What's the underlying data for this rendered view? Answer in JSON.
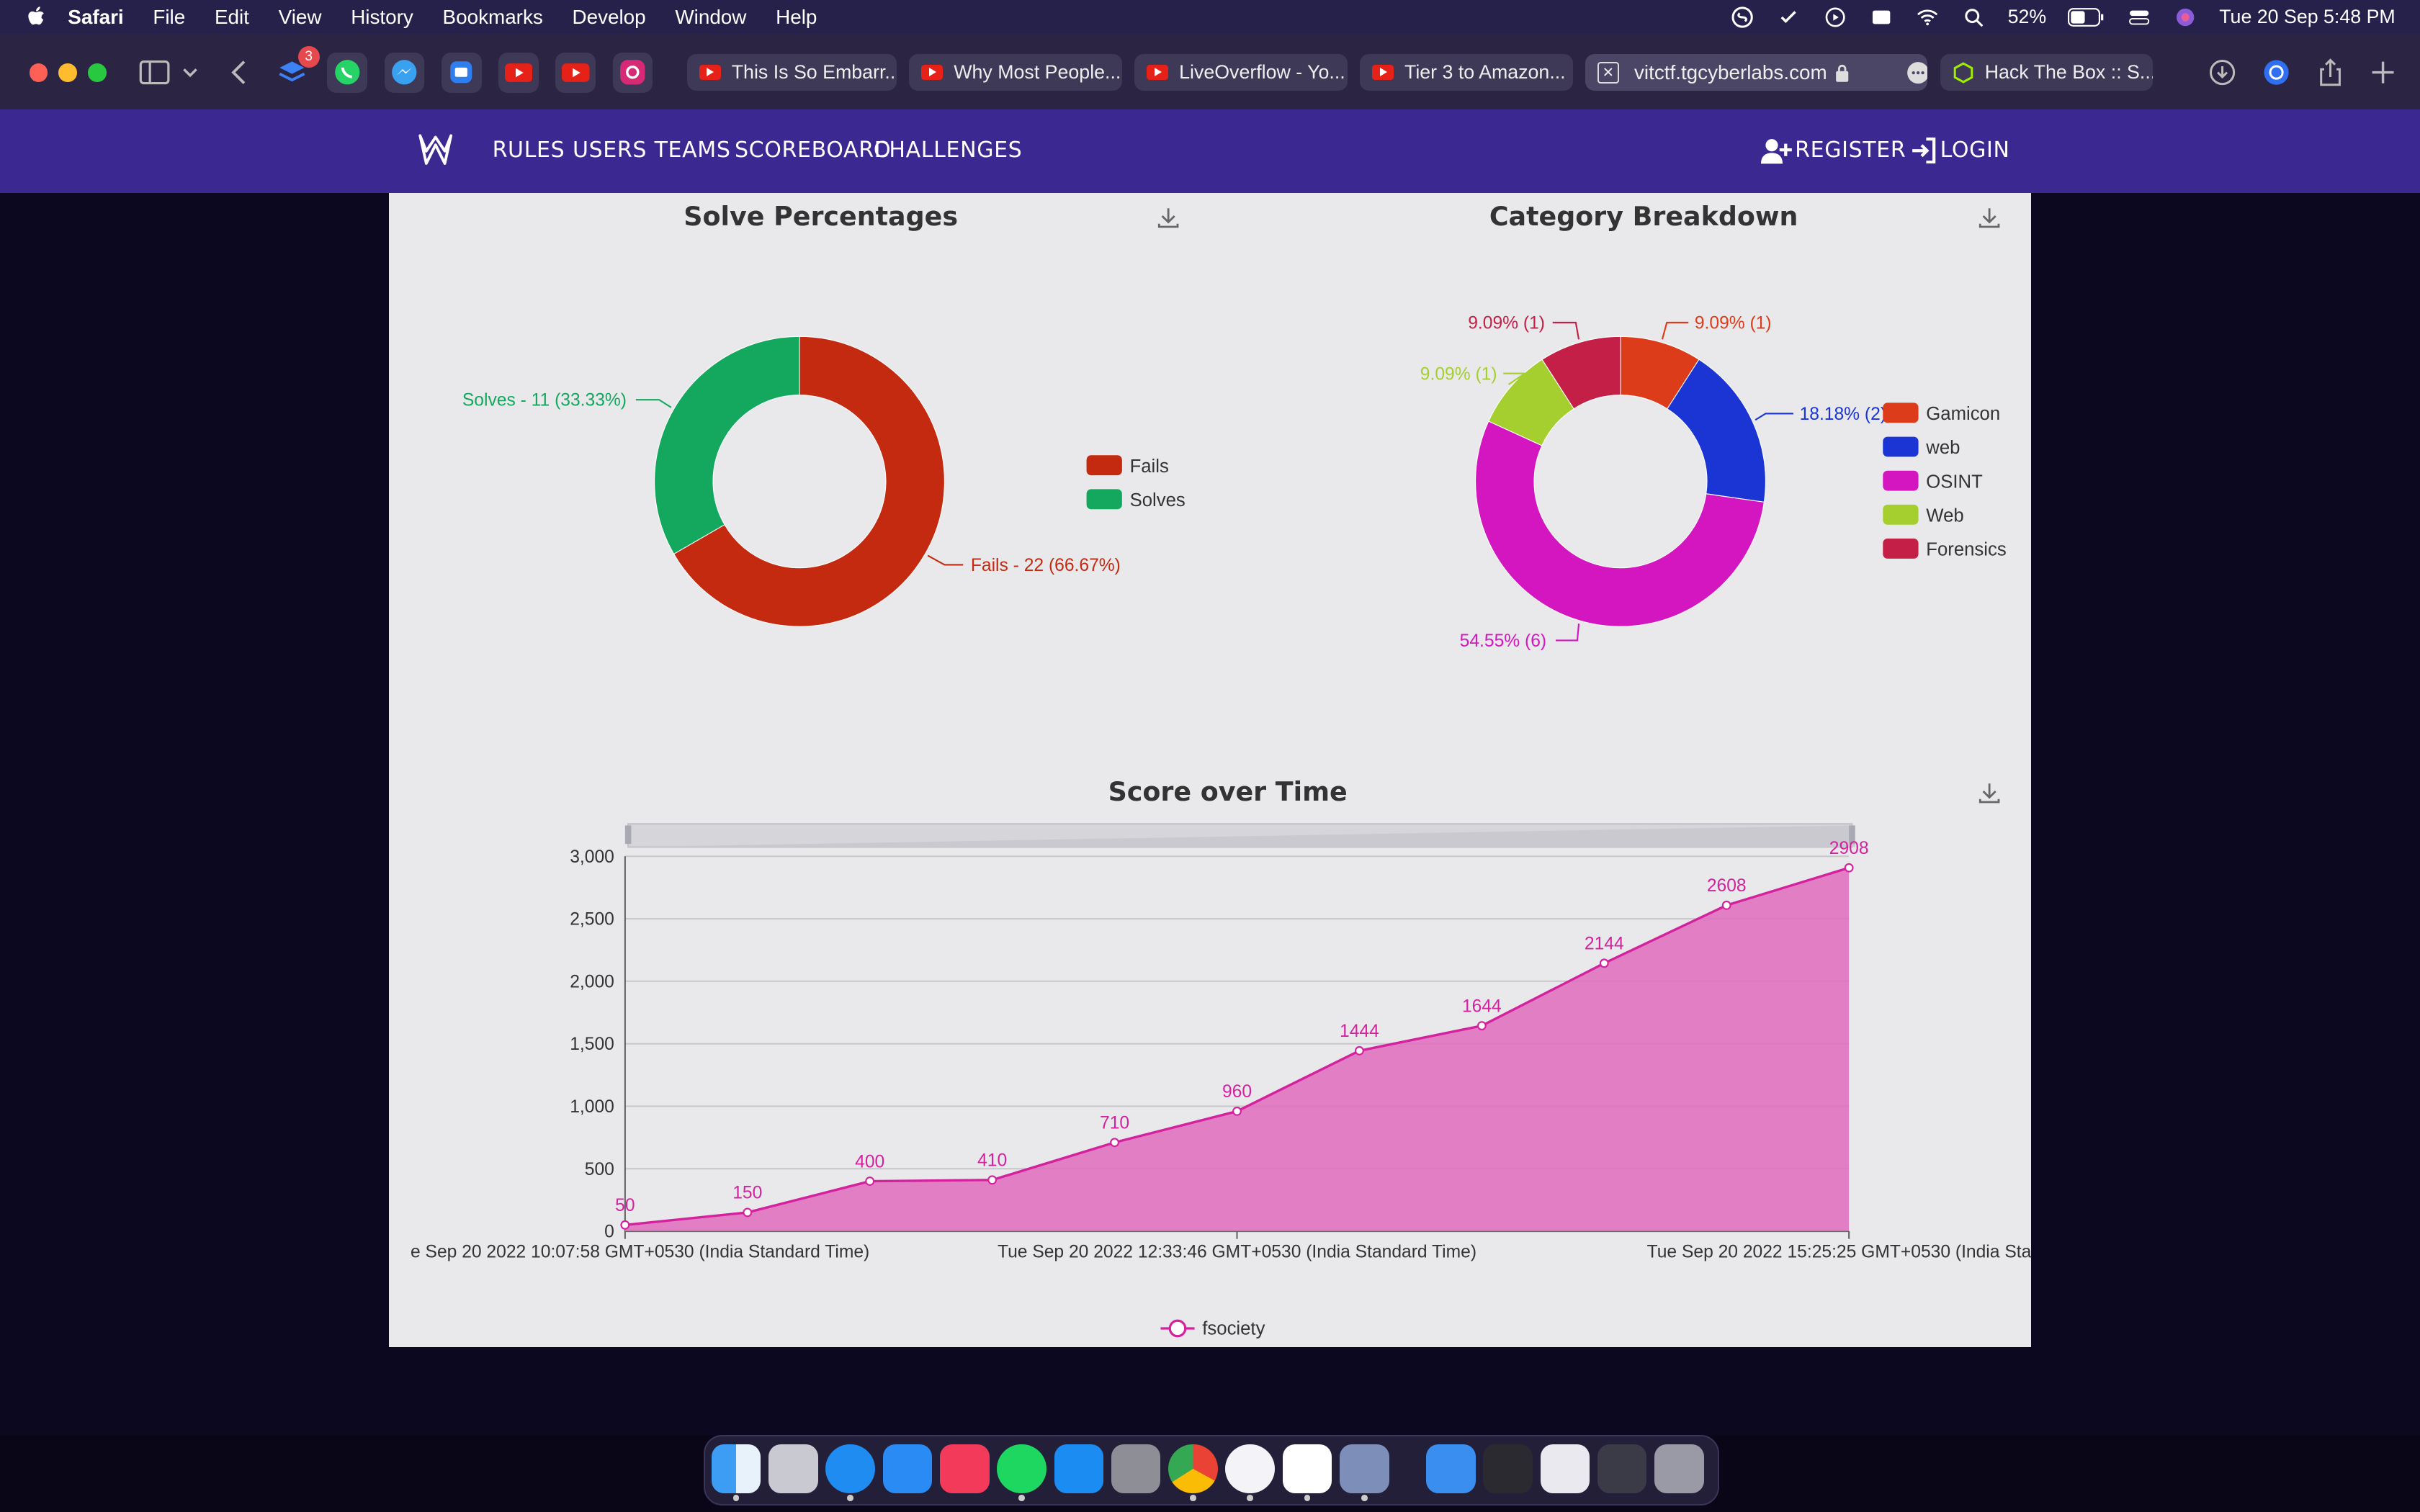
{
  "menubar": {
    "app": "Safari",
    "items": [
      "File",
      "Edit",
      "View",
      "History",
      "Bookmarks",
      "Develop",
      "Window",
      "Help"
    ],
    "battery": "52%",
    "datetime": "Tue 20 Sep  5:48 PM"
  },
  "toolbar": {
    "badge_count": "3",
    "tabs": [
      {
        "title": "This Is So Embarr..."
      },
      {
        "title": "Why Most People..."
      },
      {
        "title": "LiveOverflow - Yo..."
      },
      {
        "title": "Tier 3 to Amazon..."
      },
      {
        "title": "vitctf.tgcyberlabs.com"
      },
      {
        "title": "Hack The Box :: S..."
      }
    ]
  },
  "navbar": {
    "links": [
      "RULES",
      "USERS",
      "TEAMS",
      "SCOREBOARD",
      "CHALLENGES"
    ],
    "register": "REGISTER",
    "login": "LOGIN"
  },
  "colors": {
    "fails": "#c32a10",
    "solves": "#14a85e",
    "gamicon": "#dd3c1a",
    "web": "#1a35d4",
    "osint": "#d416c0",
    "web2": "#a4cf2e",
    "forensics": "#c41f46",
    "score_line": "#d4229f",
    "score_fill": "#e06bbd"
  },
  "chart_data": [
    {
      "type": "pie",
      "title": "Solve Percentages",
      "slices": [
        {
          "name": "Fails",
          "value": 22,
          "label": "Fails - 22 (66.67%)"
        },
        {
          "name": "Solves",
          "value": 11,
          "label": "Solves - 11 (33.33%)"
        }
      ],
      "legend": [
        "Fails",
        "Solves"
      ],
      "legend_position": "right"
    },
    {
      "type": "pie",
      "title": "Category Breakdown",
      "slices": [
        {
          "name": "Gamicon",
          "value": 1,
          "label": "9.09% (1)"
        },
        {
          "name": "web",
          "value": 2,
          "label": "18.18% (2)"
        },
        {
          "name": "OSINT",
          "value": 6,
          "label": "54.55% (6)"
        },
        {
          "name": "Web",
          "value": 1,
          "label": "9.09% (1)"
        },
        {
          "name": "Forensics",
          "value": 1,
          "label": "9.09% (1)"
        }
      ],
      "legend": [
        "Gamicon",
        "web",
        "OSINT",
        "Web",
        "Forensics"
      ],
      "legend_position": "right"
    },
    {
      "type": "area",
      "title": "Score over Time",
      "series": [
        {
          "name": "fsociety",
          "values": [
            50,
            150,
            400,
            410,
            710,
            960,
            1444,
            1644,
            2144,
            2608,
            2908
          ]
        }
      ],
      "ylim": [
        0,
        3000
      ],
      "yticks": [
        "0",
        "500",
        "1,000",
        "1,500",
        "2,000",
        "2,500",
        "3,000"
      ],
      "xtick_labels": [
        "e Sep 20 2022 10:07:58 GMT+0530 (India Standard Time)",
        "Tue Sep 20 2022 12:33:46 GMT+0530 (India Standard Time)",
        "Tue Sep 20 2022 15:25:25 GMT+0530 (India Stand"
      ],
      "grid": true,
      "legend_position": "bottom"
    }
  ]
}
